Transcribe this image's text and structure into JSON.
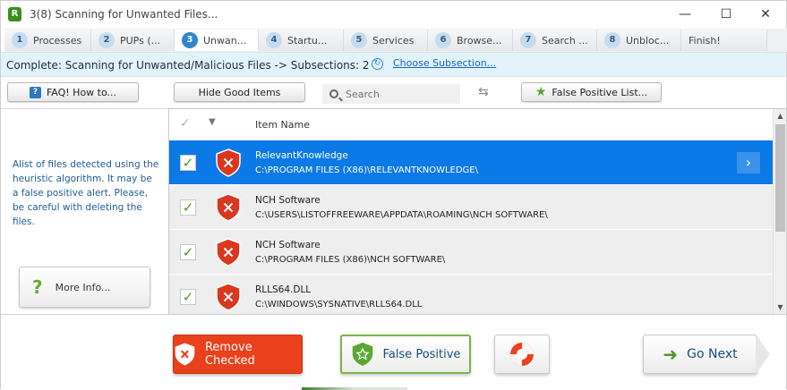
{
  "window": {
    "title": "3(8) Scanning for Unwanted Files...",
    "app_icon_letter": "R",
    "controls": {
      "minimize": "—",
      "maximize": "☐",
      "close": "✕"
    }
  },
  "steps": [
    {
      "num": "1",
      "label": "Processes"
    },
    {
      "num": "2",
      "label": "PUPs (..."
    },
    {
      "num": "3",
      "label": "Unwan..."
    },
    {
      "num": "4",
      "label": "Startu..."
    },
    {
      "num": "5",
      "label": "Services"
    },
    {
      "num": "6",
      "label": "Browse..."
    },
    {
      "num": "7",
      "label": "Search ..."
    },
    {
      "num": "8",
      "label": "Unbloc..."
    },
    {
      "num": "",
      "label": "Finish!"
    }
  ],
  "status": {
    "text": "Complete: Scanning for Unwanted/Malicious Files -> Subsections: 2",
    "link": "Choose Subsection..."
  },
  "toolbar": {
    "faq": "FAQ! How to...",
    "hide_good": "Hide Good Items",
    "search_placeholder": "Search",
    "false_positive_list": "False Positive List..."
  },
  "left_panel": {
    "description": "Alist of files detected using the heuristic algorithm. It may be a false positive alert. Please, be careful with deleting the files.",
    "more_info": "More Info..."
  },
  "list": {
    "header_name": "Item Name",
    "rows": [
      {
        "title": "RelevantKnowledge",
        "path": "C:\\PROGRAM FILES (X86)\\RELEVANTKNOWLEDGE\\",
        "checked": true
      },
      {
        "title": "NCH Software",
        "path": "C:\\USERS\\LISTOFFREEWARE\\APPDATA\\ROAMING\\NCH SOFTWARE\\",
        "checked": true
      },
      {
        "title": "NCH Software",
        "path": "C:\\PROGRAM FILES (X86)\\NCH SOFTWARE\\",
        "checked": true
      },
      {
        "title": "RLLS64.DLL",
        "path": "C:\\WINDOWS\\SYSNATIVE\\RLLS64.DLL",
        "checked": true
      }
    ]
  },
  "bottom": {
    "remove_checked": "Remove Checked",
    "false_positive": "False Positive",
    "go_next": "Go Next"
  },
  "colors": {
    "accent": "#0b79e6",
    "danger": "#e9411c",
    "ok_green": "#79b548",
    "status_bg": "#e3f3fa"
  }
}
